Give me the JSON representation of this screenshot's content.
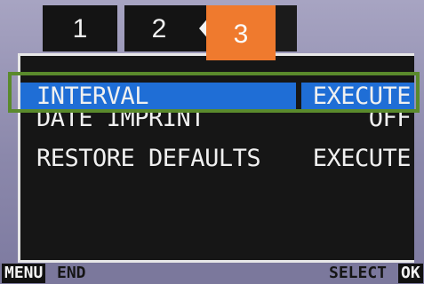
{
  "tabs": [
    {
      "label": "1"
    },
    {
      "label": "2"
    },
    {
      "label": "3"
    }
  ],
  "menu": {
    "items": [
      {
        "label": "INTERVAL",
        "value": "EXECUTE",
        "selected": true
      },
      {
        "label": "DATE IMPRINT",
        "value": "OFF"
      },
      {
        "label": "RESTORE DEFAULTS",
        "value": "EXECUTE"
      }
    ]
  },
  "footer": {
    "menu_key": "MENU",
    "menu_action": "END",
    "select_action": "SELECT",
    "ok_key": "OK"
  },
  "colors": {
    "active_tab": "#ef7a2e",
    "selection": "#1f6ed6",
    "highlight_box": "#5a8a2c"
  }
}
